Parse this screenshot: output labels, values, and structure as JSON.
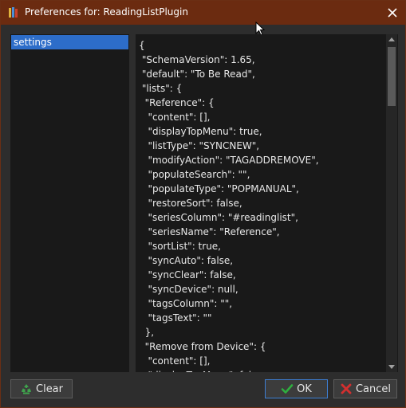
{
  "window": {
    "title": "Preferences for: ReadingListPlugin"
  },
  "sidebar": {
    "items": [
      {
        "label": "settings",
        "selected": true
      }
    ]
  },
  "editor": {
    "lines": [
      "{",
      " \"SchemaVersion\": 1.65,",
      " \"default\": \"To Be Read\",",
      " \"lists\": {",
      "  \"Reference\": {",
      "   \"content\": [],",
      "   \"displayTopMenu\": true,",
      "   \"listType\": \"SYNCNEW\",",
      "   \"modifyAction\": \"TAGADDREMOVE\",",
      "   \"populateSearch\": \"\",",
      "   \"populateType\": \"POPMANUAL\",",
      "   \"restoreSort\": false,",
      "   \"seriesColumn\": \"#readinglist\",",
      "   \"seriesName\": \"Reference\",",
      "   \"sortList\": true,",
      "   \"syncAuto\": false,",
      "   \"syncClear\": false,",
      "   \"syncDevice\": null,",
      "   \"tagsColumn\": \"\",",
      "   \"tagsText\": \"\"",
      "  },",
      "  \"Remove from Device\": {",
      "   \"content\": [],",
      "   \"displayTopMenu\": fal"
    ]
  },
  "buttons": {
    "clear_label": "Clear",
    "ok_label": "OK",
    "cancel_label": "Cancel"
  },
  "colors": {
    "titlebar": "#6b2b10",
    "selection": "#2d6dc9",
    "ok_icon": "#2fae3f",
    "cancel_icon": "#d32f2f",
    "clear_icon": "#3fa34d"
  },
  "icons": {
    "app": "book-stack-icon",
    "close": "close-icon",
    "clear": "recycle-icon",
    "ok": "checkmark-icon",
    "cancel": "x-mark-icon"
  }
}
